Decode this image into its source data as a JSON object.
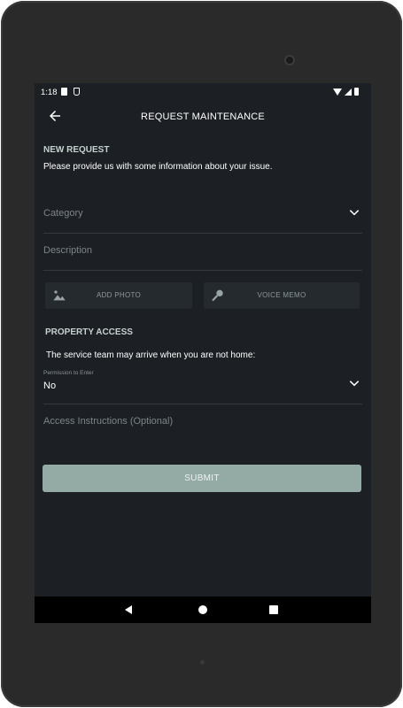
{
  "status_bar": {
    "time": "1:18",
    "icons": [
      "notification-icon",
      "shield-icon",
      "wifi-icon",
      "signal-icon",
      "battery-icon"
    ]
  },
  "app_bar": {
    "title": "REQUEST MAINTENANCE",
    "back_icon": "back-arrow-icon"
  },
  "new_request": {
    "heading": "NEW REQUEST",
    "intro": "Please provide us with some information about your issue.",
    "category_placeholder": "Category",
    "description_placeholder": "Description",
    "add_photo_label": "ADD PHOTO",
    "voice_memo_label": "VOICE MEMO"
  },
  "property_access": {
    "heading": "PROPERTY ACCESS",
    "note": "The service team may arrive when you are not home:",
    "permission_label": "Permission to Enter",
    "permission_value": "No",
    "instructions_placeholder": "Access Instructions (Optional)"
  },
  "submit_label": "SUBMIT",
  "colors": {
    "screen_background": "#1c2024",
    "accent_button": "#93aaa5",
    "section_heading": "#c6d1cf",
    "placeholder": "#7d8589"
  }
}
